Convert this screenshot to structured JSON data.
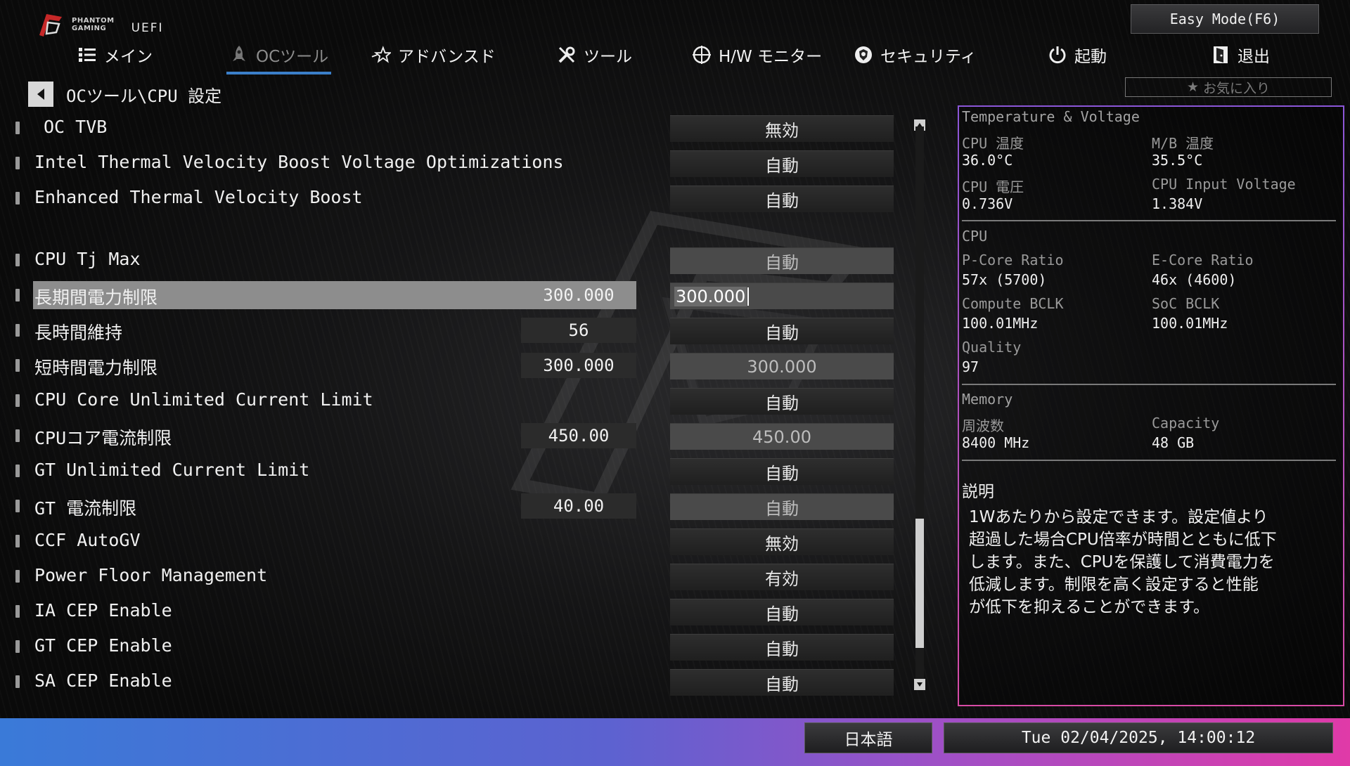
{
  "header": {
    "brand_line1": "PHANTOM",
    "brand_line2": "GAMING",
    "uefi": "UEFI",
    "easy_mode": "Easy Mode(F6)"
  },
  "nav": [
    {
      "label": "メイン",
      "icon": "list-icon"
    },
    {
      "label": "OCツール",
      "icon": "rocket-icon",
      "active": true
    },
    {
      "label": "アドバンスド",
      "icon": "star-icon"
    },
    {
      "label": "ツール",
      "icon": "tools-icon"
    },
    {
      "label": "H/W モニター",
      "icon": "crosshair-icon"
    },
    {
      "label": "セキュリティ",
      "icon": "shield-icon"
    },
    {
      "label": "起動",
      "icon": "power-icon"
    },
    {
      "label": "退出",
      "icon": "exit-door-icon"
    }
  ],
  "breadcrumb": "OCツール\\CPU 設定",
  "favorite": "お気に入り",
  "settings": [
    {
      "label": "OC TVB",
      "current": "",
      "option": "無効"
    },
    {
      "label": "Intel Thermal Velocity Boost Voltage Optimizations",
      "current": "",
      "option": "自動"
    },
    {
      "label": "Enhanced Thermal Velocity Boost",
      "current": "",
      "option": "自動"
    },
    {
      "label": "CPU Tj Max",
      "current": "",
      "option": "自動"
    },
    {
      "label": "長期間電力制限",
      "current": "300.000",
      "option": "300.000"
    },
    {
      "label": "長時間維持",
      "current": "56",
      "option": "自動"
    },
    {
      "label": "短時間電力制限",
      "current": "300.000",
      "option": "300.000"
    },
    {
      "label": "CPU Core Unlimited Current Limit",
      "current": "",
      "option": "自動"
    },
    {
      "label": "CPUコア電流制限",
      "current": "450.00",
      "option": "450.00"
    },
    {
      "label": "GT Unlimited Current Limit",
      "current": "",
      "option": "自動"
    },
    {
      "label": "GT 電流制限",
      "current": "40.00",
      "option": "自動"
    },
    {
      "label": "CCF AutoGV",
      "current": "",
      "option": "無効"
    },
    {
      "label": "Power Floor Management",
      "current": "",
      "option": "有効"
    },
    {
      "label": "IA CEP Enable",
      "current": "",
      "option": "自動"
    },
    {
      "label": "GT CEP Enable",
      "current": "",
      "option": "自動"
    },
    {
      "label": "SA CEP Enable",
      "current": "",
      "option": "自動"
    }
  ],
  "panel": {
    "tv_title": "Temperature & Voltage",
    "cpu_temp_label": "CPU 温度",
    "cpu_temp": "36.0°C",
    "mb_temp_label": "M/B 温度",
    "mb_temp": "35.5°C",
    "cpu_volt_label": "CPU 電圧",
    "cpu_volt": "0.736V",
    "cpu_input_label": "CPU Input Voltage",
    "cpu_input": "1.384V",
    "cpu_title": "CPU",
    "pcore_label": "P-Core Ratio",
    "pcore": "57x (5700)",
    "ecore_label": "E-Core Ratio",
    "ecore": "46x (4600)",
    "bclk_label": "Compute BCLK",
    "bclk": "100.01MHz",
    "soc_label": "SoC BCLK",
    "soc": "100.01MHz",
    "quality_label": "Quality",
    "quality": "97",
    "mem_title": "Memory",
    "freq_label": "周波数",
    "freq": "8400 MHz",
    "cap_label": "Capacity",
    "cap": "48 GB",
    "desc_title": "説明",
    "desc_text": " 1Wあたりから設定できます。設定値より\n超過した場合CPU倍率が時間とともに低下\nします。また、CPUを保護して消費電力を\n低減します。制限を高く設定すると性能\nが低下を抑えることができます。"
  },
  "footer": {
    "language": "日本語",
    "datetime": "Tue 02/04/2025, 14:00:12"
  },
  "colors": {
    "accent": "#3b7fc9",
    "panel_border_top": "#8b56d8",
    "panel_border_bottom": "#d84ba6"
  }
}
